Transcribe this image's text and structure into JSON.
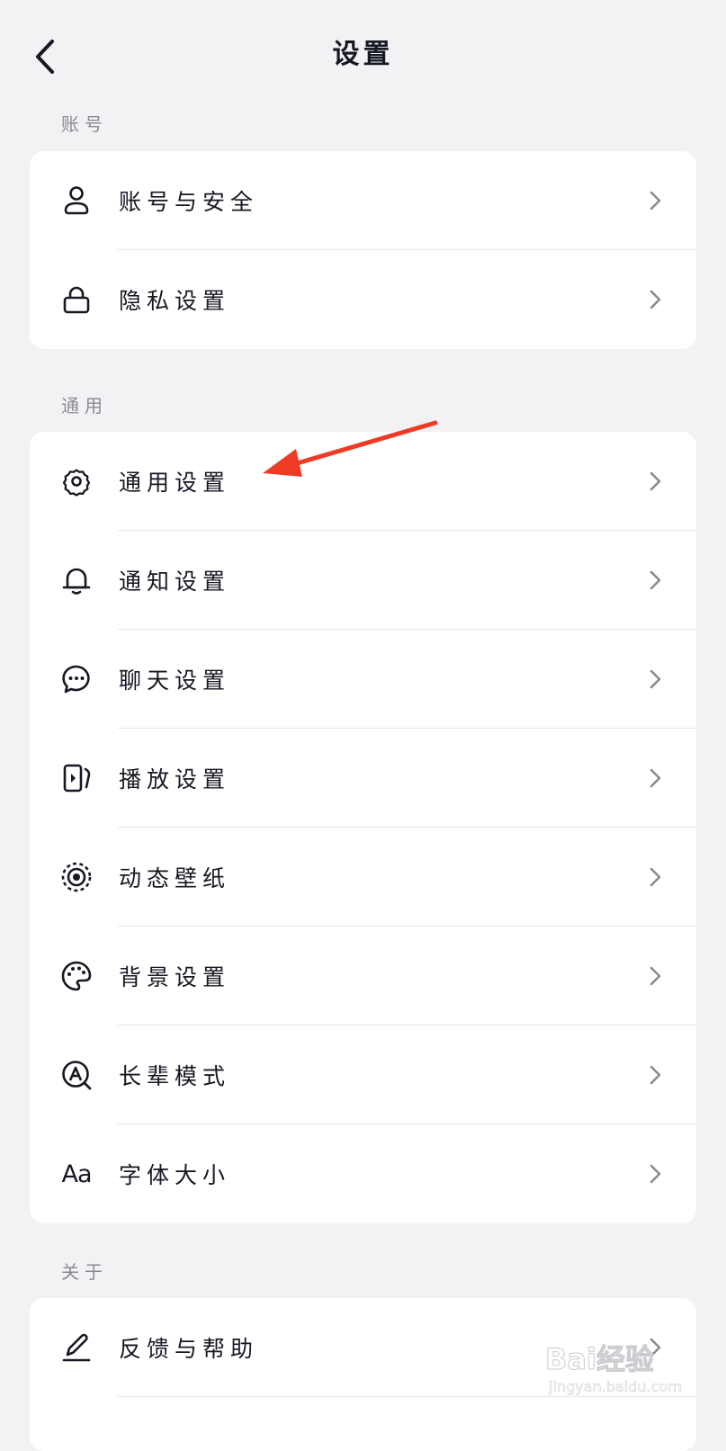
{
  "header": {
    "title": "设置"
  },
  "sections": [
    {
      "label": "账号",
      "items": [
        {
          "label": "账号与安全",
          "icon": "user-icon"
        },
        {
          "label": "隐私设置",
          "icon": "lock-icon"
        }
      ]
    },
    {
      "label": "通用",
      "items": [
        {
          "label": "通用设置",
          "icon": "gear-icon"
        },
        {
          "label": "通知设置",
          "icon": "bell-icon"
        },
        {
          "label": "聊天设置",
          "icon": "chat-bubble-icon"
        },
        {
          "label": "播放设置",
          "icon": "play-icon"
        },
        {
          "label": "动态壁纸",
          "icon": "wallpaper-icon"
        },
        {
          "label": "背景设置",
          "icon": "palette-icon"
        },
        {
          "label": "长辈模式",
          "icon": "elder-mode-icon"
        },
        {
          "label": "字体大小",
          "icon": "font-size-icon",
          "icon_text": "Aa"
        }
      ]
    },
    {
      "label": "关于",
      "items": [
        {
          "label": "反馈与帮助",
          "icon": "edit-icon"
        }
      ]
    }
  ],
  "annotation": {
    "color": "#ee3b25",
    "target": "通用设置"
  },
  "watermark": {
    "main": "Bai经验",
    "sub": "jingyan.baidu.com"
  }
}
